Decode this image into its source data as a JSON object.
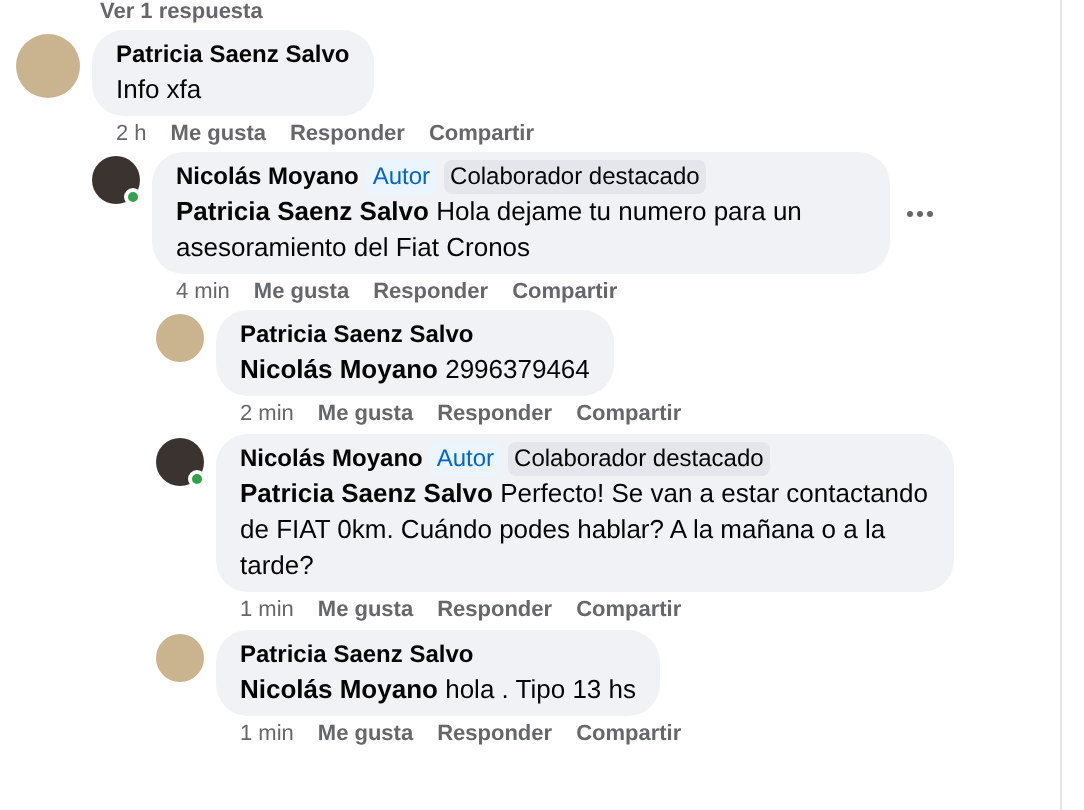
{
  "view_replies": "Ver 1 respuesta",
  "comments": [
    {
      "author": "Patricia Saenz Salvo",
      "online": false,
      "text": "Info xfa",
      "time": "2 h",
      "actions": [
        "Me gusta",
        "Responder",
        "Compartir"
      ],
      "menu": false,
      "children": [
        {
          "author": "Nicolás Moyano",
          "badges": [
            {
              "label": "Autor",
              "kind": "author"
            },
            {
              "label": "Colaborador destacado",
              "kind": "top"
            }
          ],
          "online": true,
          "mention": "Patricia Saenz Salvo",
          "text": "Hola dejame tu numero para un asesoramiento del Fiat Cronos",
          "time": "4 min",
          "actions": [
            "Me gusta",
            "Responder",
            "Compartir"
          ],
          "menu": true,
          "children": [
            {
              "author": "Patricia Saenz Salvo",
              "online": false,
              "mention": "Nicolás Moyano",
              "text": "2996379464",
              "time": "2 min",
              "actions": [
                "Me gusta",
                "Responder",
                "Compartir"
              ],
              "menu": false
            },
            {
              "author": "Nicolás Moyano",
              "badges": [
                {
                  "label": "Autor",
                  "kind": "author"
                },
                {
                  "label": "Colaborador destacado",
                  "kind": "top"
                }
              ],
              "online": true,
              "mention": "Patricia Saenz Salvo",
              "text": "Perfecto! Se van a estar contactando de FIAT 0km. Cuándo podes hablar? A la mañana o a la tarde?",
              "time": "1 min",
              "actions": [
                "Me gusta",
                "Responder",
                "Compartir"
              ],
              "menu": false
            },
            {
              "author": "Patricia Saenz Salvo",
              "online": false,
              "mention": "Nicolás Moyano",
              "text": "hola . Tipo 13 hs",
              "time": "1 min",
              "actions": [
                "Me gusta",
                "Responder",
                "Compartir"
              ],
              "menu": false
            }
          ]
        }
      ]
    }
  ]
}
